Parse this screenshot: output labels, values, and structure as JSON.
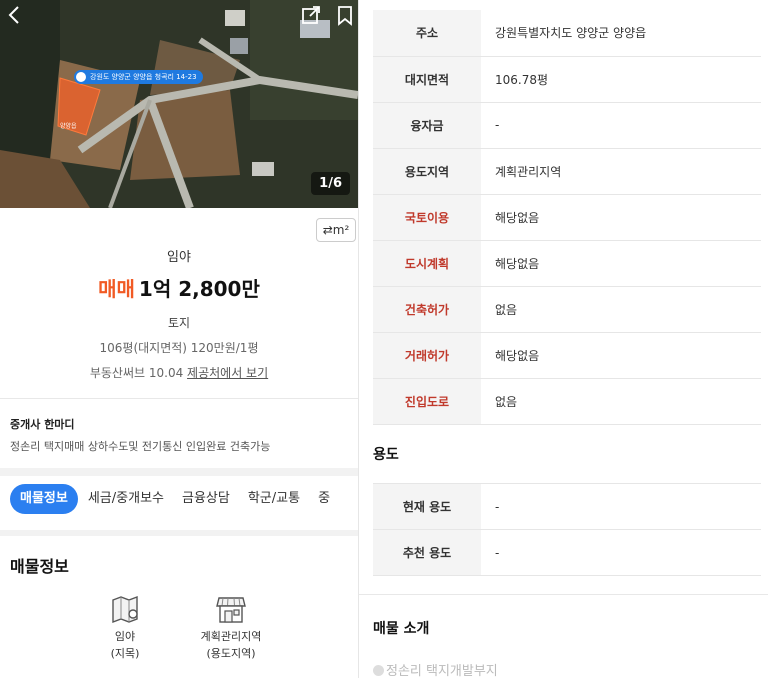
{
  "photo": {
    "pin_label": "강원도 양양군 양양읍 청곡리 14-23",
    "plot_label": "양양읍",
    "counter": "1/6"
  },
  "summary": {
    "unit_toggle": "m²",
    "category": "임야",
    "deal_type": "매매",
    "price": "1억 2,800만",
    "land_type": "토지",
    "area_info": "106평(대지면적)  120만원/1평",
    "source": "부동산써브 10.04",
    "source_link": "제공처에서 보기"
  },
  "agent": {
    "title": "중개사 한마디",
    "comment": "정손리 택지매매 상하수도및 전기통신 인입완료 건축가능"
  },
  "tabs": [
    {
      "label": "매물정보"
    },
    {
      "label": "세금/중개보수"
    },
    {
      "label": "금융상담"
    },
    {
      "label": "학군/교통"
    },
    {
      "label": "중"
    }
  ],
  "left_section": {
    "title": "매물정보",
    "features": [
      {
        "line1": "임야",
        "line2": "(지목)",
        "icon": "land-map-icon"
      },
      {
        "line1": "계획관리지역",
        "line2": "(용도지역)",
        "icon": "storefront-icon"
      }
    ]
  },
  "info_rows": [
    {
      "key": "주소",
      "value": "강원특별자치도 양양군 양양읍"
    },
    {
      "key": "대지면적",
      "value": "106.78평"
    },
    {
      "key": "융자금",
      "value": "-"
    },
    {
      "key": "용도지역",
      "value": "계획관리지역"
    },
    {
      "key": "국토이용",
      "value": "해당없음",
      "accent": true
    },
    {
      "key": "도시계획",
      "value": "해당없음",
      "accent": true
    },
    {
      "key": "건축허가",
      "value": "없음",
      "accent": true
    },
    {
      "key": "거래허가",
      "value": "해당없음",
      "accent": true
    },
    {
      "key": "진입도로",
      "value": "없음",
      "accent": true
    }
  ],
  "usage": {
    "title": "용도",
    "rows": [
      {
        "key": "현재 용도",
        "value": "-"
      },
      {
        "key": "추천 용도",
        "value": "-"
      }
    ]
  },
  "intro": {
    "title": "매물 소개",
    "faded_text": "정손리 택지개발부지"
  },
  "colors": {
    "accent_orange": "#f15a24",
    "tab_blue": "#2b7ff0",
    "plot_orange": "#e8622b",
    "accent_key": "#c0392b"
  }
}
